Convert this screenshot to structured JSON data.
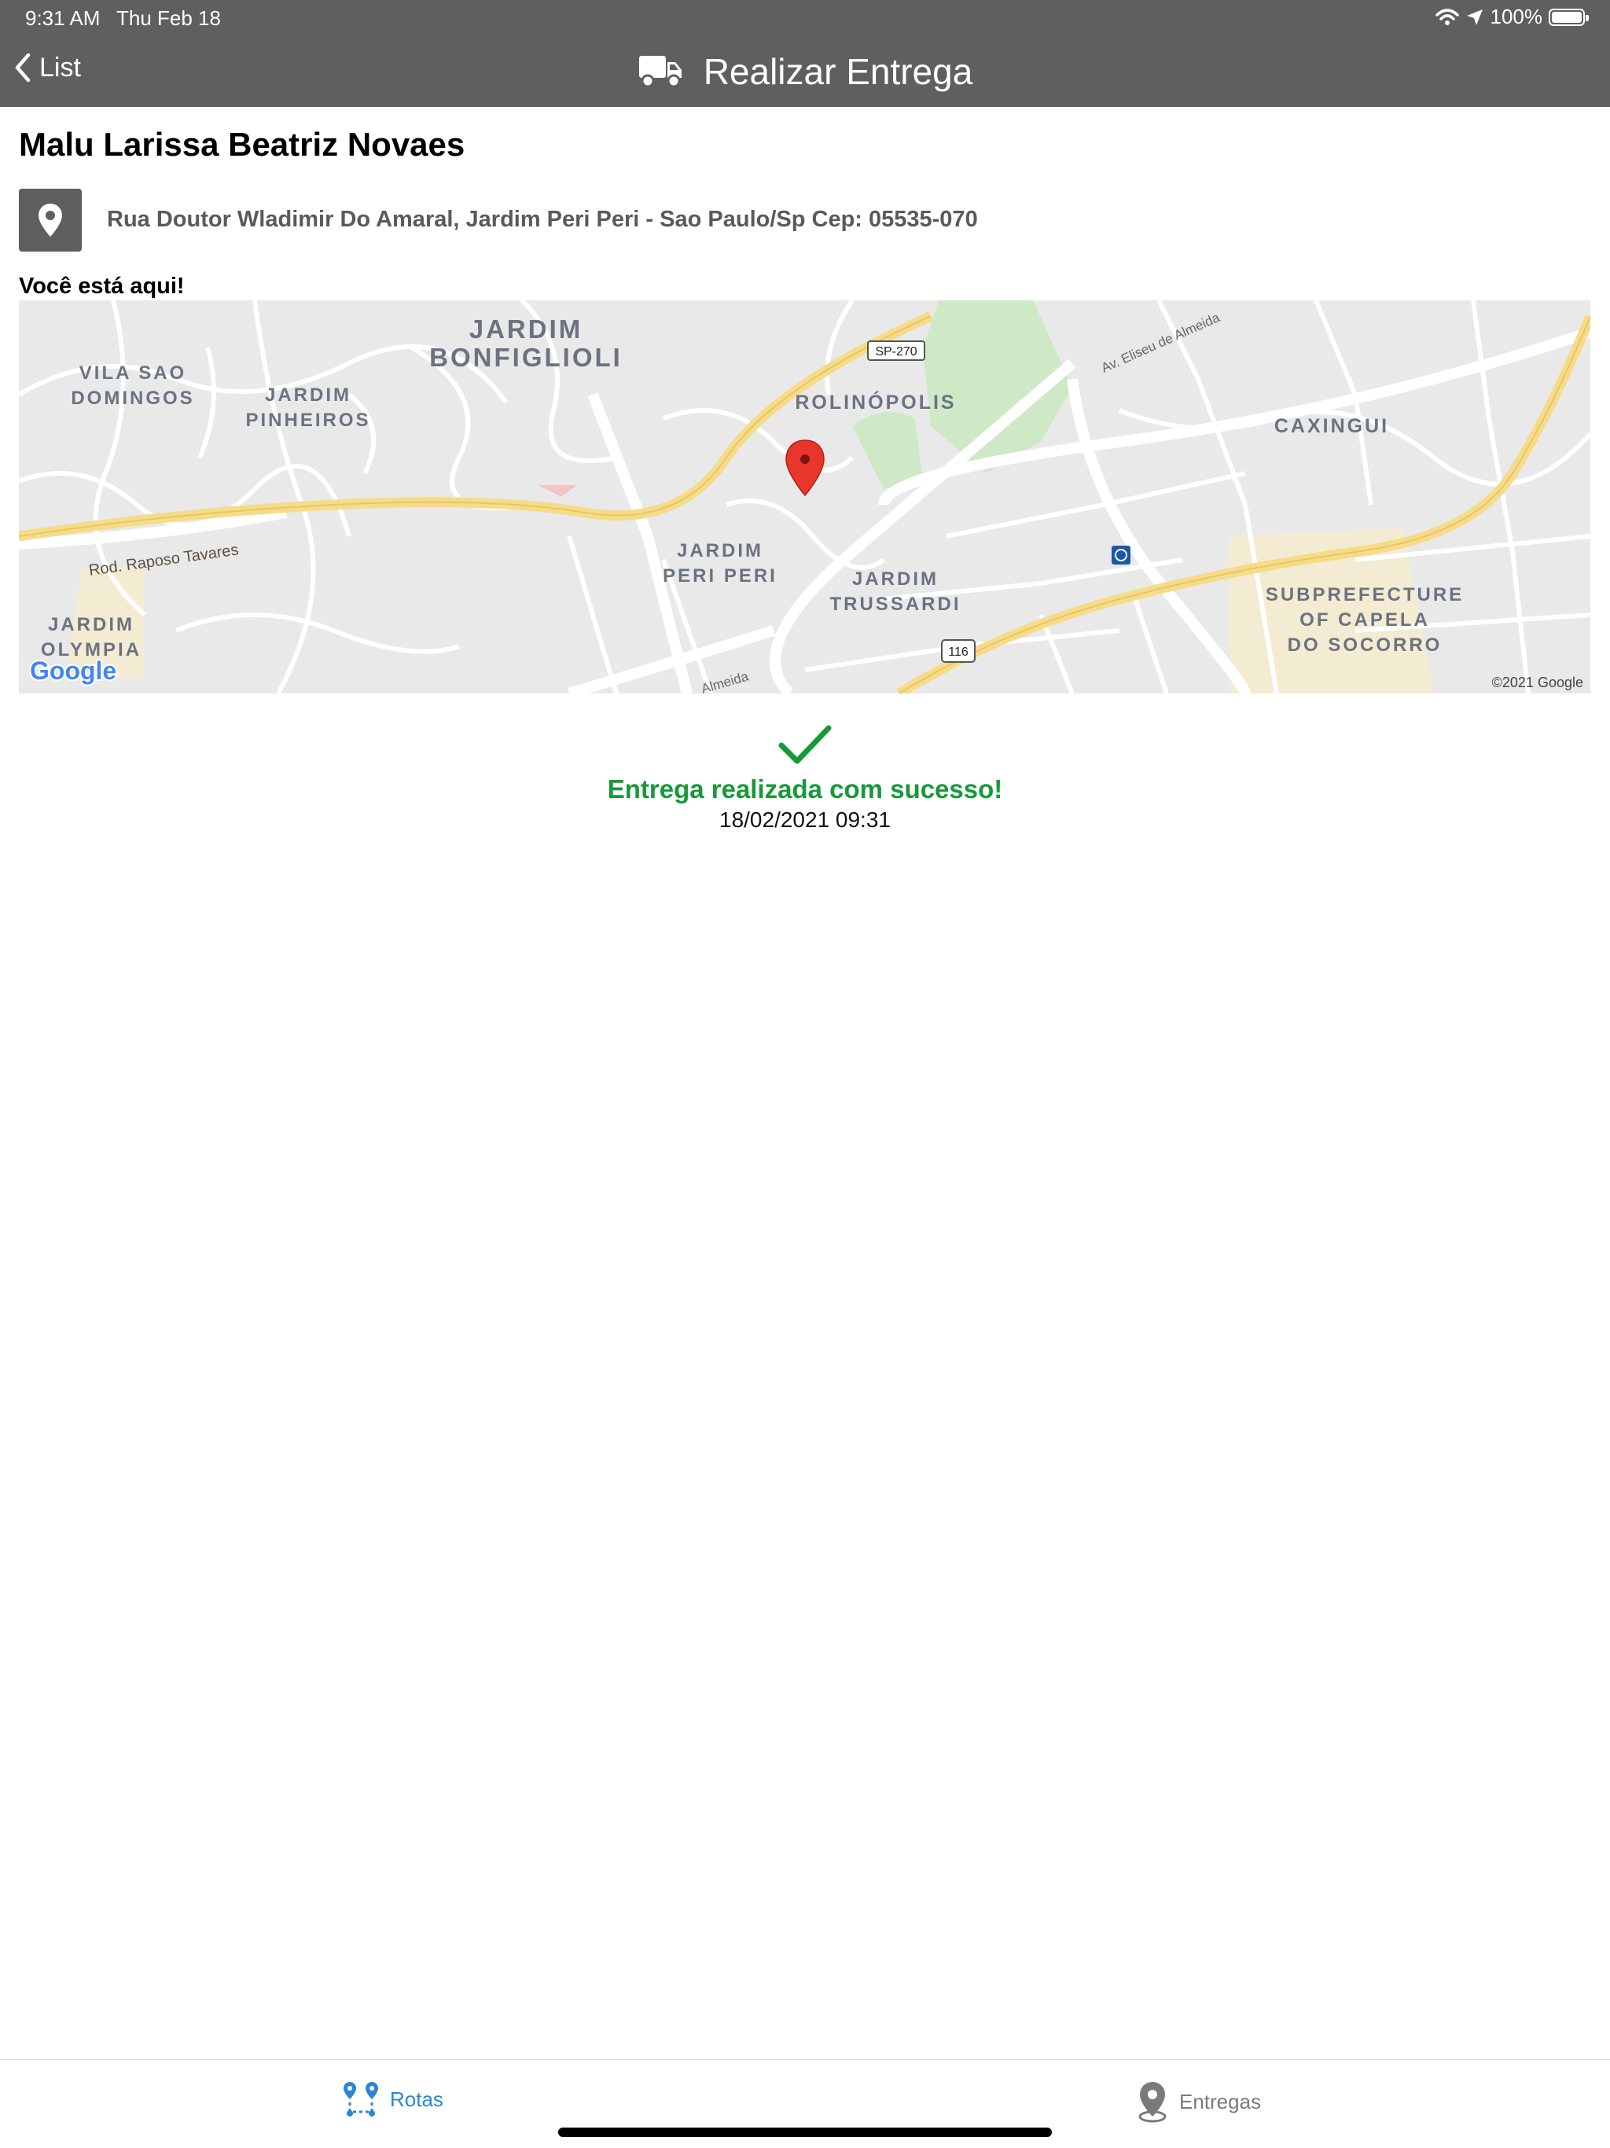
{
  "status_bar": {
    "time": "9:31 AM",
    "date": "Thu Feb 18",
    "battery": "100%",
    "battery_level": 1.0
  },
  "nav": {
    "back_label": "List",
    "title": "Realizar Entrega",
    "title_icon": "truck-icon"
  },
  "customer": {
    "name": "Malu Larissa Beatriz Novaes",
    "address": "Rua Doutor Wladimir Do Amaral, Jardim Peri Peri - Sao Paulo/Sp Cep: 05535-070"
  },
  "map": {
    "caption": "Você está aqui!",
    "labels": {
      "vila_sao": "VILA SAO",
      "domingos": "DOMINGOS",
      "jardim_pinheiros_1": "JARDIM",
      "jardim_pinheiros_2": "PINHEIROS",
      "jardim_bonfiglioli_1": "JARDIM",
      "jardim_bonfiglioli_2": "BONFIGLIOLI",
      "rolinopolis": "ROLINÓPOLIS",
      "caxingui": "CAXINGUI",
      "jardim_peri_1": "JARDIM",
      "jardim_peri_2": "PERI PERI",
      "jardim_trussardi_1": "JARDIM",
      "jardim_trussardi_2": "TRUSSARDI",
      "subprefecture_1": "SUBPREFECTURE",
      "subprefecture_2": "OF CAPELA",
      "subprefecture_3": "DO SOCORRO",
      "jardim_olympia_1": "JARDIM",
      "jardim_olympia_2": "OLYMPIA",
      "rod_raposo": "Rod. Raposo Tavares",
      "av_eliseu": "Av. Eliseu de Almeida",
      "almeida": "Almeida",
      "sp270": "SP-270",
      "r116": "116",
      "google": "Google",
      "copyright": "©2021 Google"
    }
  },
  "delivery": {
    "status": "Entrega realizada com sucesso!",
    "datetime": "18/02/2021 09:31"
  },
  "tabs": [
    {
      "label": "Rotas",
      "icon": "route-icon",
      "active": true,
      "color": "#2a86d4"
    },
    {
      "label": "Entregas",
      "icon": "map-pin-icon",
      "active": false,
      "color": "#7a7a7a"
    }
  ],
  "colors": {
    "header": "#5f5f5f",
    "success": "#169a3a",
    "active_tab": "#2a86d4",
    "road": "#f6dc8a",
    "park": "#cfe9c7",
    "marker": "#e8362b"
  }
}
